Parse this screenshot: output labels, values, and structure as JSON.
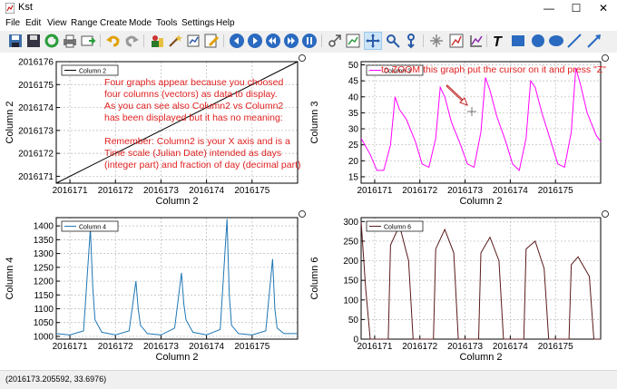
{
  "window": {
    "title": "Kst",
    "minimize": "—",
    "maximize": "☐",
    "close": "✕"
  },
  "menu": [
    "File",
    "Edit",
    "View",
    "Range",
    "Create",
    "Mode",
    "Tools",
    "Settings",
    "Help"
  ],
  "toolbar_icons": [
    "save-icon",
    "save-as-icon",
    "reload-icon",
    "print-icon",
    "export-icon",
    "undo-icon",
    "redo-icon",
    "data-manager-icon",
    "data-wizard-icon",
    "plugin-icon",
    "edit-icon",
    "back-icon",
    "forward-icon",
    "first-icon",
    "last-icon",
    "pause-icon",
    "layout-mode-icon",
    "zoom-mode-icon",
    "zoom-x-icon",
    "zoom-y-icon",
    "select-mode-icon",
    "grid-icon",
    "plot-icon",
    "text-icon",
    "box-icon",
    "circle-icon",
    "ellipse-icon",
    "line-icon",
    "arrow-icon"
  ],
  "status": "(2016173.205592, 33.6976)",
  "annotation_zoom": "to ZOOM this graph put the cursor on it and press \"Z\"",
  "annotation_main": [
    "Four graphs appear because you choosed",
    "four columns (vectors) as data to display.",
    "As you can see also Column2 vs Column2",
    "has been displayed but it has no meaning:",
    "",
    "Remember: Column2 is your X axis and is a",
    "Time scale (Julian Date) intended as days",
    "(integer part) and fraction of day (decimal part)"
  ],
  "chart_data": [
    {
      "type": "line",
      "xlabel": "Column 2",
      "ylabel": "Column 2",
      "legend": "Column 2",
      "xlim": [
        2016170.7,
        2016176.0
      ],
      "ylim": [
        2016170.7,
        2016176.0
      ],
      "xticks": [
        "2016171",
        "2016172",
        "2016173",
        "2016174",
        "2016175"
      ],
      "yticks": [
        "2016171",
        "2016172",
        "2016173",
        "2016174",
        "2016175",
        "2016176"
      ],
      "color": "#000000",
      "series": [
        {
          "name": "Column 2",
          "x": [
            2016170.7,
            2016176.0
          ],
          "y": [
            2016170.7,
            2016176.0
          ]
        }
      ]
    },
    {
      "type": "line",
      "xlabel": "Column 2",
      "ylabel": "Column 3",
      "legend": "Column 3",
      "xlim": [
        2016170.7,
        2016176.0
      ],
      "ylim": [
        13,
        51
      ],
      "xticks": [
        "2016171",
        "2016172",
        "2016173",
        "2016174",
        "2016175"
      ],
      "yticks": [
        "15",
        "20",
        "25",
        "30",
        "35",
        "40",
        "45",
        "50"
      ],
      "color": "#ff00ff",
      "series": [
        {
          "name": "Column 3",
          "x": [
            2016170.7,
            2016170.9,
            2016171.05,
            2016171.2,
            2016171.35,
            2016171.45,
            2016171.55,
            2016171.7,
            2016171.9,
            2016172.05,
            2016172.2,
            2016172.35,
            2016172.45,
            2016172.55,
            2016172.7,
            2016172.9,
            2016173.05,
            2016173.2,
            2016173.35,
            2016173.45,
            2016173.55,
            2016173.7,
            2016173.9,
            2016174.05,
            2016174.2,
            2016174.35,
            2016174.45,
            2016174.55,
            2016174.7,
            2016174.9,
            2016175.05,
            2016175.2,
            2016175.35,
            2016175.45,
            2016175.55,
            2016175.7,
            2016175.9,
            2016176.0
          ],
          "y": [
            27,
            22,
            17,
            17,
            25,
            40,
            36,
            33,
            26,
            19,
            18,
            27,
            43,
            40,
            32,
            25,
            19,
            18,
            29,
            46,
            42,
            34,
            26,
            19,
            17,
            27,
            45,
            43,
            35,
            26,
            19,
            18,
            29,
            49,
            44,
            35,
            28,
            26
          ]
        }
      ]
    },
    {
      "type": "line",
      "xlabel": "Column 2",
      "ylabel": "Column 4",
      "legend": "Column 4",
      "xlim": [
        2016170.7,
        2016176.0
      ],
      "ylim": [
        990,
        1430
      ],
      "xticks": [
        "2016171",
        "2016172",
        "2016173",
        "2016174",
        "2016175"
      ],
      "yticks": [
        "1000",
        "1050",
        "1100",
        "1150",
        "1200",
        "1250",
        "1300",
        "1350",
        "1400"
      ],
      "color": "#1f77b4",
      "series": [
        {
          "name": "Column 4",
          "x": [
            2016170.7,
            2016171.0,
            2016171.3,
            2016171.45,
            2016171.5,
            2016171.55,
            2016171.7,
            2016172.0,
            2016172.3,
            2016172.45,
            2016172.5,
            2016172.55,
            2016172.7,
            2016173.0,
            2016173.3,
            2016173.45,
            2016173.5,
            2016173.55,
            2016173.7,
            2016174.0,
            2016174.3,
            2016174.45,
            2016174.5,
            2016174.55,
            2016174.7,
            2016175.0,
            2016175.3,
            2016175.45,
            2016175.5,
            2016175.55,
            2016175.7,
            2016176.0
          ],
          "y": [
            1010,
            1005,
            1020,
            1390,
            1180,
            1060,
            1015,
            1005,
            1020,
            1200,
            1100,
            1040,
            1010,
            1005,
            1030,
            1230,
            1120,
            1060,
            1015,
            1005,
            1025,
            1425,
            1150,
            1040,
            1010,
            1005,
            1020,
            1280,
            1100,
            1030,
            1010,
            1010
          ]
        }
      ]
    },
    {
      "type": "line",
      "xlabel": "Column 2",
      "ylabel": "Column 6",
      "legend": "Column 6",
      "xlim": [
        2016170.7,
        2016176.0
      ],
      "ylim": [
        0,
        310
      ],
      "xticks": [
        "2016171",
        "2016172",
        "2016173",
        "2016174",
        "2016175"
      ],
      "yticks": [
        "0",
        "50",
        "100",
        "150",
        "200",
        "250",
        "300"
      ],
      "color": "#5a1a1a",
      "series": [
        {
          "name": "Column 6",
          "x": [
            2016170.7,
            2016170.8,
            2016170.9,
            2016171.0,
            2016171.05,
            2016171.3,
            2016171.35,
            2016171.55,
            2016171.75,
            2016171.85,
            2016172.05,
            2016172.3,
            2016172.35,
            2016172.55,
            2016172.75,
            2016172.85,
            2016173.05,
            2016173.3,
            2016173.35,
            2016173.55,
            2016173.75,
            2016173.85,
            2016174.05,
            2016174.3,
            2016174.35,
            2016174.55,
            2016174.75,
            2016174.85,
            2016175.05,
            2016175.3,
            2016175.35,
            2016175.5,
            2016175.75,
            2016175.85,
            2016176.0
          ],
          "y": [
            300,
            130,
            0,
            0,
            0,
            0,
            240,
            290,
            200,
            0,
            0,
            0,
            230,
            280,
            220,
            0,
            0,
            0,
            220,
            260,
            200,
            0,
            0,
            0,
            230,
            250,
            180,
            0,
            0,
            0,
            190,
            210,
            160,
            0,
            0
          ]
        }
      ]
    }
  ]
}
